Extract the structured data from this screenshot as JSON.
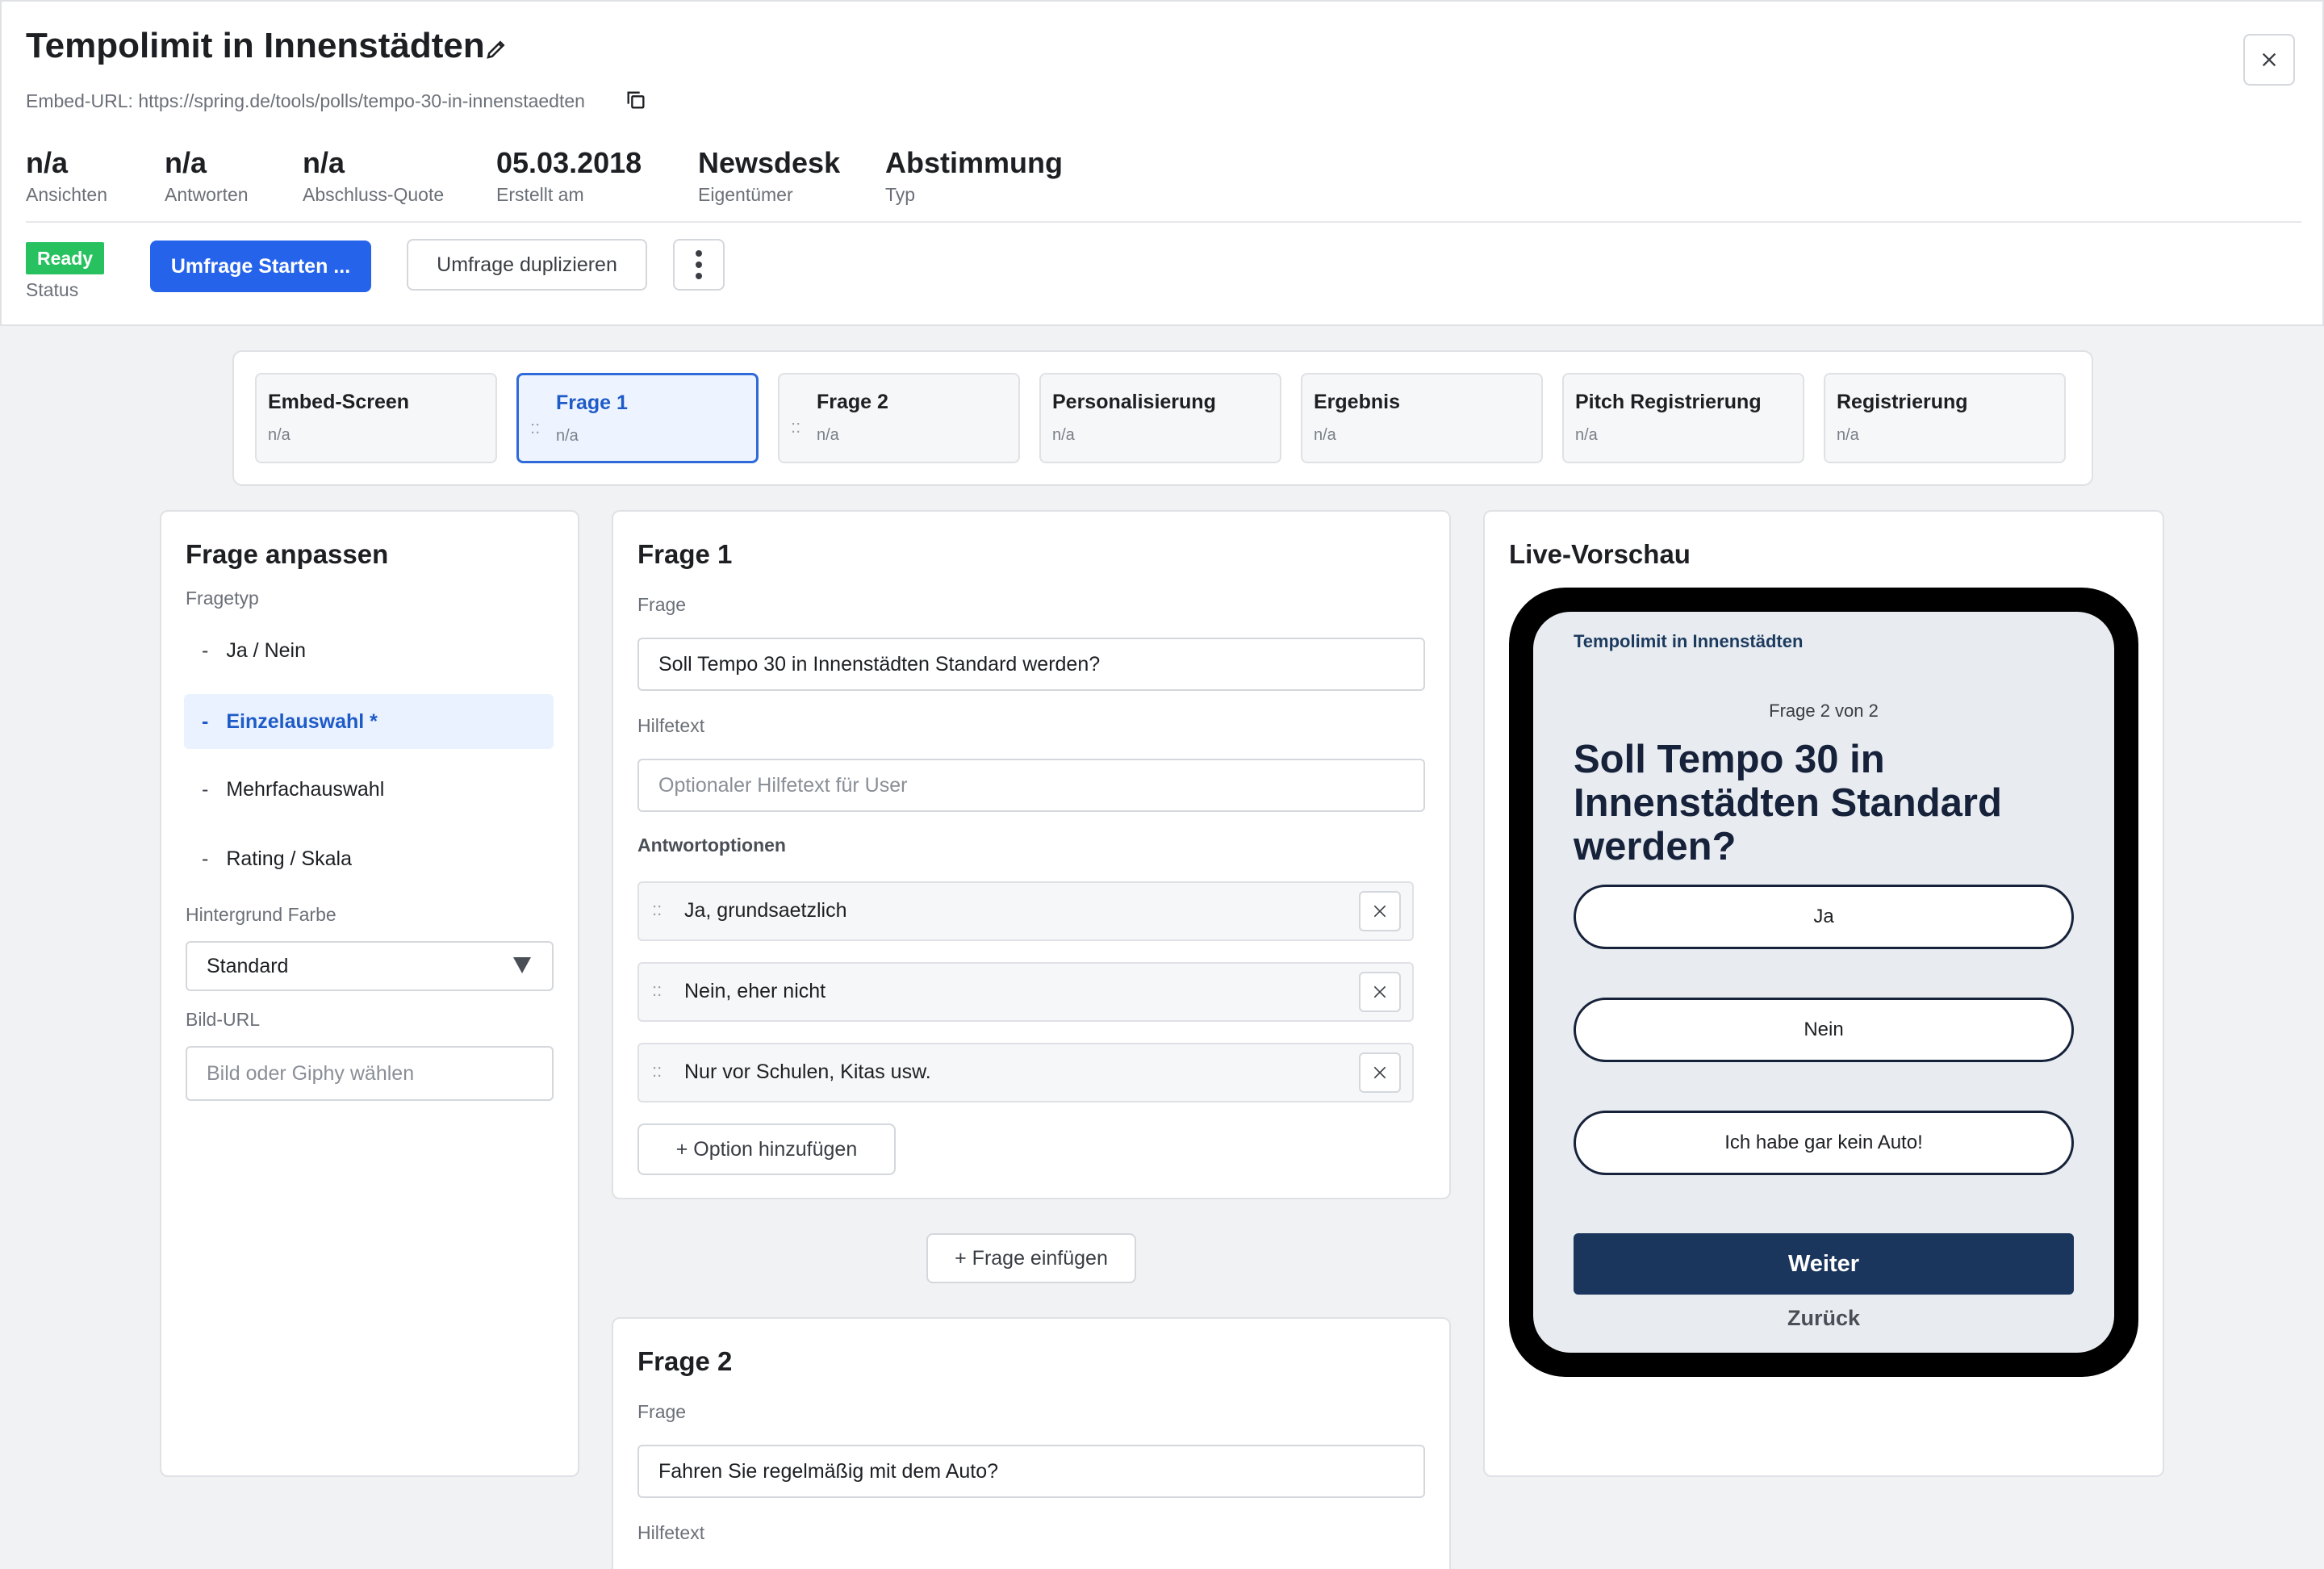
{
  "header": {
    "title": "Tempolimit in Innenstädten",
    "embed_url": "Embed-URL: https://spring.de/tools/polls/tempo-30-in-innenstaedten",
    "stats": [
      {
        "value": "n/a",
        "label": "Ansichten"
      },
      {
        "value": "n/a",
        "label": "Antworten"
      },
      {
        "value": "n/a",
        "label": "Abschluss-Quote"
      },
      {
        "value": "05.03.2018",
        "label": "Erstellt am"
      },
      {
        "value": "Newsdesk",
        "label": "Eigentümer"
      },
      {
        "value": "Abstimmung",
        "label": "Typ"
      }
    ],
    "status": {
      "value": "Ready",
      "label": "Status",
      "color": "#27c25f"
    },
    "start_label": "Umfrage Starten ...",
    "duplicate_label": "Umfrage duplizieren"
  },
  "tabs": [
    {
      "label": "Embed-Screen",
      "sub": "n/a"
    },
    {
      "label": "Frage 1",
      "sub": "n/a"
    },
    {
      "label": "Frage 2",
      "sub": "n/a"
    },
    {
      "label": "Personalisierung",
      "sub": "n/a"
    },
    {
      "label": "Ergebnis",
      "sub": "n/a"
    },
    {
      "label": "Pitch Registrierung",
      "sub": "n/a"
    },
    {
      "label": "Registrierung",
      "sub": "n/a"
    }
  ],
  "customize": {
    "title": "Frage anpassen",
    "type_label": "Fragetyp",
    "types": [
      "Ja / Nein",
      "Einzelauswahl *",
      "Mehrfachauswahl",
      "Rating / Skala"
    ],
    "types_dash": "-",
    "bg_label": "Hintergrund Farbe",
    "bg_value": "Standard",
    "image_label": "Bild-URL",
    "image_placeholder": "Bild oder Giphy wählen"
  },
  "question1": {
    "title": "Frage 1",
    "question_label": "Frage",
    "question_value": "Soll Tempo 30 in Innenstädten Standard werden?",
    "help_label": "Hilfetext",
    "help_placeholder": "Optionaler Hilfetext für User",
    "options_label": "Antwortoptionen",
    "options": [
      "Ja, grundsaetzlich",
      "Nein, eher nicht",
      "Nur vor Schulen, Kitas usw."
    ],
    "add_option_label": "+ Option hinzufügen"
  },
  "insert_question_label": "+ Frage einfügen",
  "question2": {
    "title": "Frage 2",
    "question_label": "Frage",
    "question_value": "Fahren Sie regelmäßig mit dem Auto?",
    "help_label": "Hilfetext"
  },
  "preview": {
    "title": "Live-Vorschau",
    "poll_title": "Tempolimit in Innenstädten",
    "counter": "Frage 2 von 2",
    "question": "Soll Tempo 30 in Innenstädten Standard werden?",
    "answers": [
      "Ja",
      "Nein",
      "Ich habe gar kein Auto!"
    ],
    "next_label": "Weiter",
    "back_label": "Zurück",
    "accent_color": "#1b365d"
  },
  "grip_glyph": "::",
  "colors": {
    "primary": "#2563eb",
    "active_tab": "#2f6bd8"
  }
}
